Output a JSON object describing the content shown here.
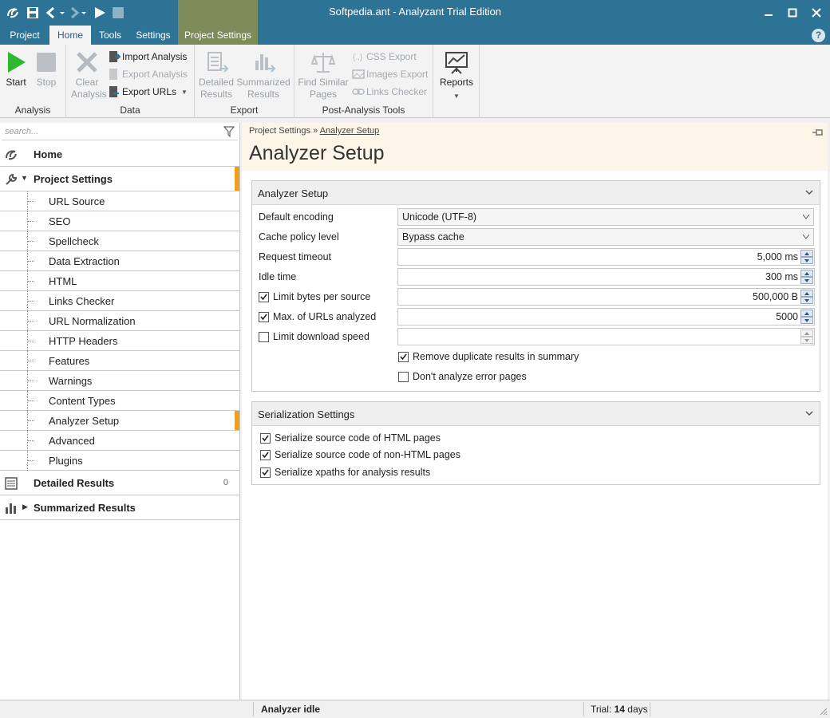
{
  "window": {
    "title": "Softpedia.ant - Analyzant Trial Edition"
  },
  "menu_tabs": [
    {
      "label": "Project"
    },
    {
      "label": "Home"
    },
    {
      "label": "Tools"
    },
    {
      "label": "Settings"
    },
    {
      "label": "Project Settings"
    }
  ],
  "help_label": "?",
  "ribbon": {
    "analysis": {
      "label": "Analysis",
      "start": "Start",
      "stop": "Stop"
    },
    "data": {
      "label": "Data",
      "clear_1": "Clear",
      "clear_2": "Analysis",
      "import": "Import Analysis",
      "export_analysis": "Export Analysis",
      "export_urls": "Export URLs"
    },
    "export": {
      "label": "Export",
      "detailed_1": "Detailed",
      "detailed_2": "Results",
      "summarized_1": "Summarized",
      "summarized_2": "Results"
    },
    "post": {
      "label": "Post-Analysis Tools",
      "find_1": "Find Similar",
      "find_2": "Pages",
      "css": "CSS Export",
      "images": "Images Export",
      "links": "Links Checker"
    },
    "reports": {
      "label": "Reports"
    }
  },
  "sidebar": {
    "search_placeholder": "search...",
    "home": "Home",
    "project_settings": "Project Settings",
    "sub_items": [
      "URL Source",
      "SEO",
      "Spellcheck",
      "Data Extraction",
      "HTML",
      "Links Checker",
      "URL Normalization",
      "HTTP Headers",
      "Features",
      "Warnings",
      "Content Types",
      "Analyzer Setup",
      "Advanced",
      "Plugins"
    ],
    "detailed_results": "Detailed Results",
    "detailed_count": "0",
    "summarized_results": "Summarized Results"
  },
  "main": {
    "breadcrumb_1": "Project Settings",
    "breadcrumb_sep": "»",
    "breadcrumb_2": "Analyzer Setup",
    "page_title": "Analyzer Setup",
    "analyzer_panel": {
      "title": "Analyzer Setup",
      "default_encoding_label": "Default encoding",
      "default_encoding_value": "Unicode (UTF-8)",
      "cache_policy_label": "Cache policy level",
      "cache_policy_value": "Bypass cache",
      "request_timeout_label": "Request timeout",
      "request_timeout_value": "5,000 ms",
      "idle_time_label": "Idle time",
      "idle_time_value": "300 ms",
      "limit_bytes_label": "Limit bytes per source",
      "limit_bytes_value": "500,000 B",
      "max_urls_label": "Max. of URLs analyzed",
      "max_urls_value": "5000",
      "limit_download_label": "Limit download speed",
      "limit_download_value": "",
      "remove_duplicate_label": "Remove duplicate results in summary",
      "dont_analyze_label": "Don't analyze error pages"
    },
    "serialization_panel": {
      "title": "Serialization Settings",
      "html_label": "Serialize source code of HTML pages",
      "nonhtml_label": "Serialize source code of non-HTML pages",
      "xpaths_label": "Serialize xpaths for analysis results"
    }
  },
  "statusbar": {
    "status": "Analyzer idle",
    "trial_prefix": "Trial:",
    "trial_days": "14",
    "trial_suffix": "days"
  },
  "colors": {
    "titlebar": "#2d7396",
    "context_tab": "#7d8a5a",
    "selection_accent": "#f0a020",
    "start_green": "#2db82d",
    "header_bg": "#fdf5e8"
  }
}
